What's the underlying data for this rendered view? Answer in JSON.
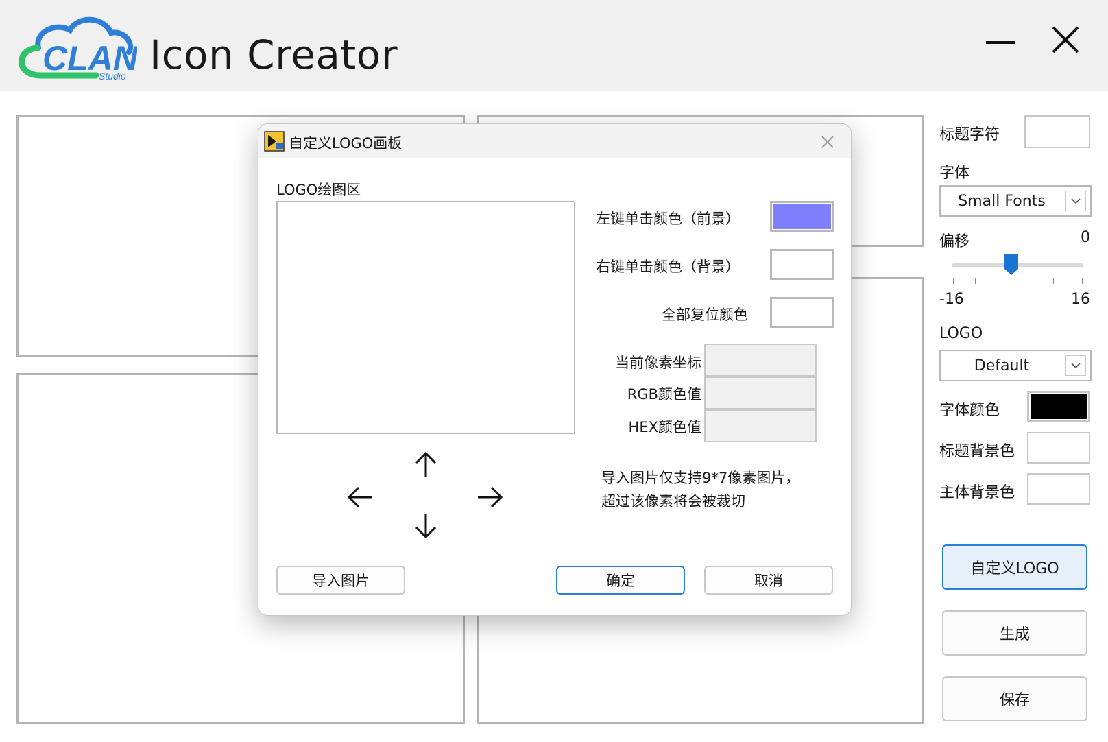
{
  "app": {
    "title": "Icon Creator",
    "logo_text": "CLAN",
    "logo_sub": "Studio"
  },
  "sidebar": {
    "title_chars_label": "标题字符",
    "font_label": "字体",
    "font_value": "Small Fonts",
    "offset_label": "偏移",
    "offset_value": "0",
    "offset_min": "-16",
    "offset_max": "16",
    "offset_level": 0,
    "logo_label": "LOGO",
    "logo_value": "Default",
    "font_color_label": "字体颜色",
    "title_bg_label": "标题背景色",
    "body_bg_label": "主体背景色",
    "custom_logo_button": "自定义LOGO",
    "generate_button": "生成",
    "save_button": "保存",
    "colors": {
      "font_color": "#000000",
      "title_bg": "#ffffff",
      "body_bg": "#ffffff"
    }
  },
  "dialog": {
    "title": "自定义LOGO画板",
    "canvas_label": "LOGO绘图区",
    "left_click_label": "左键单击颜色（前景）",
    "right_click_label": "右键单击颜色（背景）",
    "reset_label": "全部复位颜色",
    "pixel_coord_label": "当前像素坐标",
    "rgb_label": "RGB颜色值",
    "hex_label": "HEX颜色值",
    "note_line1": "导入图片仅支持9*7像素图片，",
    "note_line2": "超过该像素将会被裁切",
    "import_button": "导入图片",
    "ok_button": "确定",
    "cancel_button": "取消",
    "colors": {
      "foreground": "#8080ff",
      "background": "#ffffff",
      "reset": "#ffffff"
    }
  }
}
